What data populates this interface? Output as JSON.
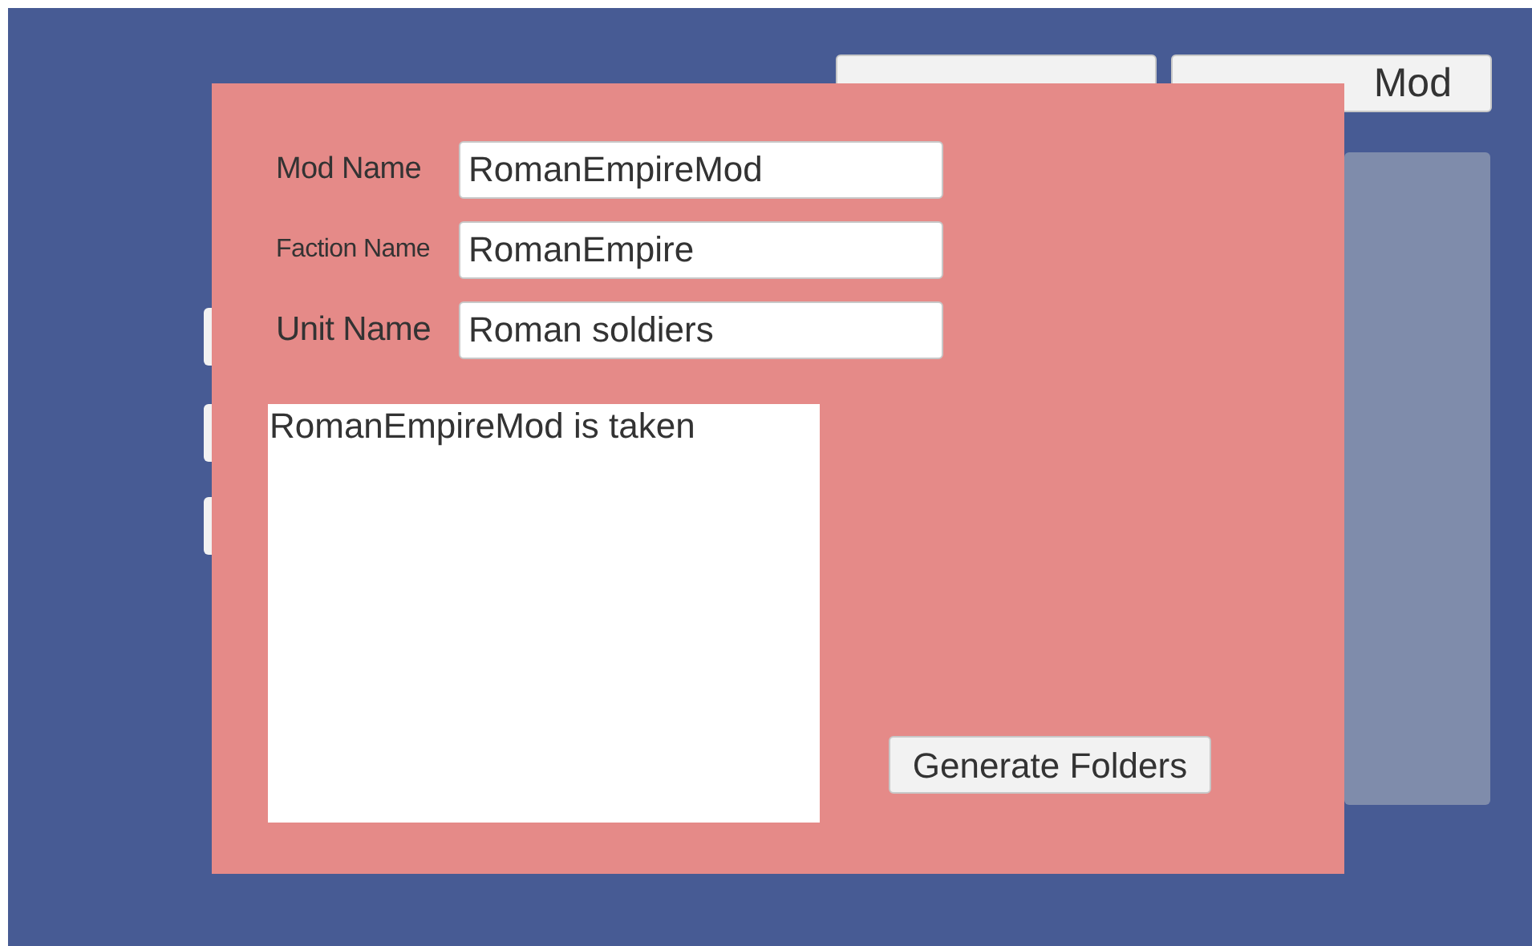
{
  "background_button": {
    "label": "Mod"
  },
  "dialog": {
    "fields": [
      {
        "label": "Mod Name",
        "value": "RomanEmpireMod"
      },
      {
        "label": "Faction Name",
        "value": "RomanEmpire"
      },
      {
        "label": "Unit Name",
        "value": "Roman soldiers"
      }
    ],
    "message": "RomanEmpireMod is taken",
    "button": "Generate Folders"
  }
}
